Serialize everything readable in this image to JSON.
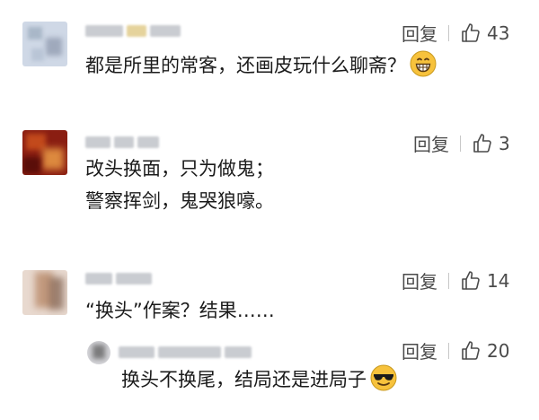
{
  "comments": [
    {
      "reply_label": "回复",
      "likes": "43",
      "text": "都是所里的常客，还画皮玩什么聊斋？",
      "emoji_icon": "grinning-face-icon"
    },
    {
      "reply_label": "回复",
      "likes": "3",
      "lines": [
        "改头换面，只为做鬼；",
        "警察挥剑，鬼哭狼嚎。"
      ]
    },
    {
      "reply_label": "回复",
      "likes": "14",
      "text": "“换头”作案？结果……"
    }
  ],
  "reply": {
    "reply_label": "回复",
    "likes": "20",
    "text": "换头不换尾，结局还是进局子",
    "emoji_icon": "sunglasses-face-icon"
  },
  "colors": {
    "action_text": "#4a4a4a",
    "body_text": "#1b1b1b",
    "emoji_yellow": "#f7c23c"
  }
}
